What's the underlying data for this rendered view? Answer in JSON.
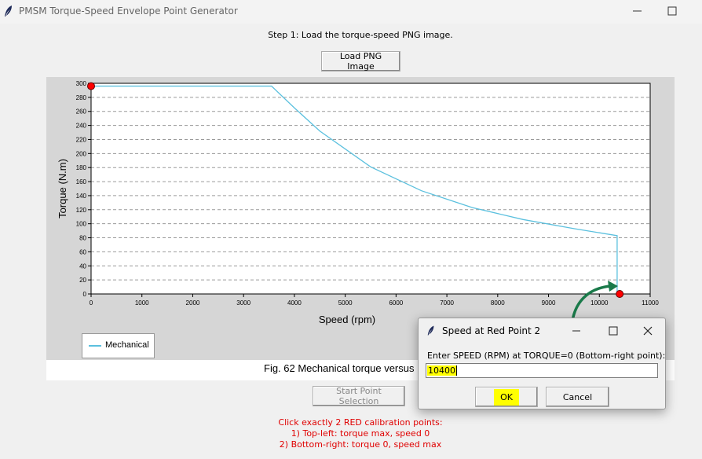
{
  "window": {
    "title": "PMSM Torque-Speed Envelope Point Generator",
    "icon": "feather-icon"
  },
  "step_text": "Step 1: Load the torque-speed PNG image.",
  "load_button": "Load PNG Image",
  "figure": {
    "caption": "Fig. 62 Mechanical torque versus",
    "legend": "Mechanical",
    "line_color": "#5bc0de",
    "marker_color": "#ff0000"
  },
  "chart_data": {
    "type": "line",
    "xlabel": "Speed (rpm)",
    "ylabel": "Torque (N.m)",
    "xlim": [
      0,
      11000
    ],
    "ylim": [
      0,
      300
    ],
    "xticks": [
      0,
      1000,
      2000,
      3000,
      4000,
      5000,
      6000,
      7000,
      8000,
      9000,
      10000,
      11000
    ],
    "yticks": [
      0,
      20,
      40,
      60,
      80,
      100,
      120,
      140,
      160,
      180,
      200,
      220,
      240,
      260,
      280,
      300
    ],
    "grid": "horizontal dashed",
    "legend_position": "bottom-left",
    "series": [
      {
        "name": "Mechanical",
        "x": [
          0,
          3550,
          4000,
          4500,
          5500,
          6500,
          7500,
          8500,
          9500,
          10350,
          10350
        ],
        "y": [
          296,
          296,
          265,
          232,
          181,
          147,
          123,
          106,
          93,
          83,
          0
        ]
      }
    ],
    "calibration_points": [
      {
        "x": 0,
        "y": 296
      },
      {
        "x": 10400,
        "y": 0
      }
    ]
  },
  "start_button": "Start Point Selection",
  "instructions": [
    "Click exactly 2 RED calibration points:",
    "1) Top-left: torque max, speed 0",
    "2) Bottom-right: torque 0, speed max"
  ],
  "dialog": {
    "title": "Speed at Red Point 2",
    "prompt": "Enter SPEED (RPM) at TORQUE=0 (Bottom-right point):",
    "input_value": "10400",
    "ok": "OK",
    "cancel": "Cancel",
    "highlight_color": "#ffff00"
  },
  "annotation": {
    "arrow_color": "#1a7a4a"
  }
}
